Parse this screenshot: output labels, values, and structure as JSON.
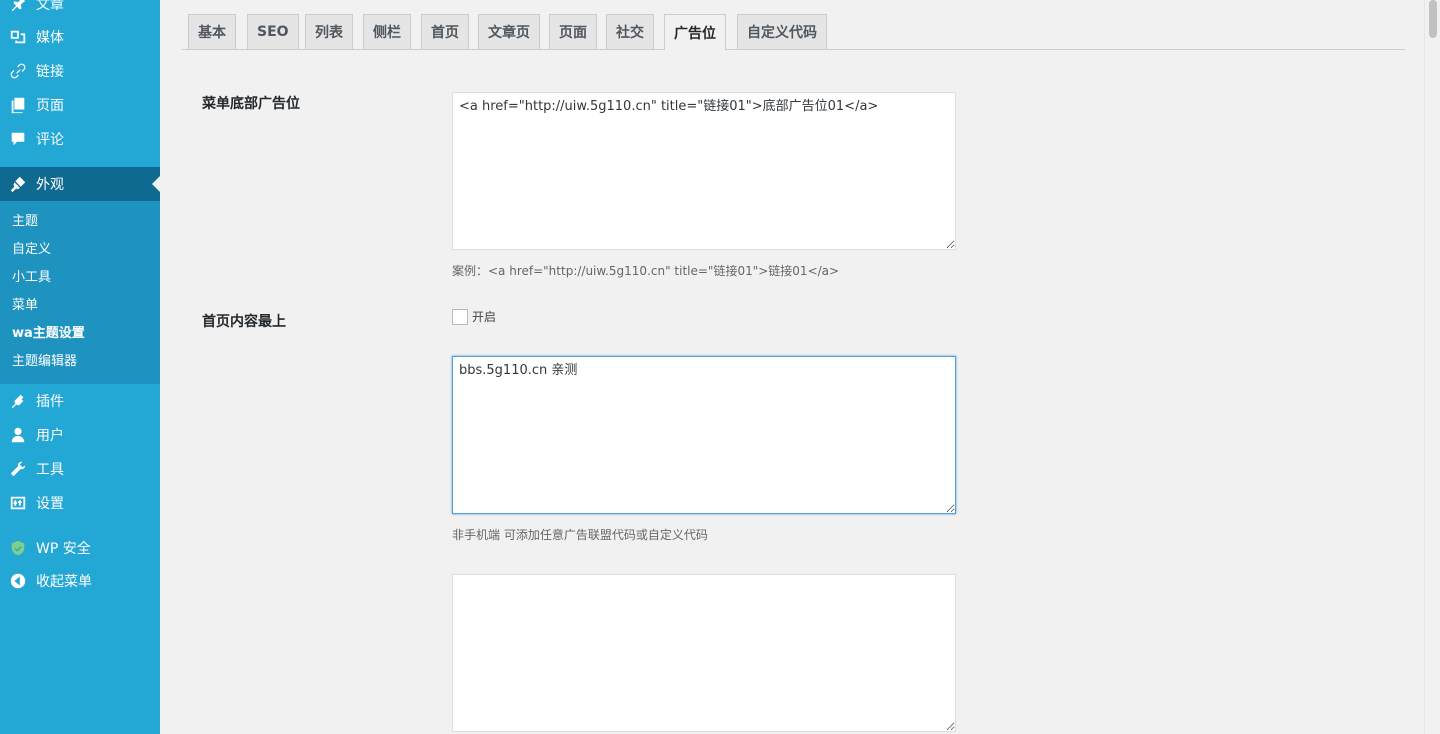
{
  "sidebar": {
    "items": [
      {
        "label": "文章",
        "icon": "pin-icon"
      },
      {
        "label": "媒体",
        "icon": "media-icon"
      },
      {
        "label": "链接",
        "icon": "link-icon"
      },
      {
        "label": "页面",
        "icon": "page-icon"
      },
      {
        "label": "评论",
        "icon": "comment-icon"
      },
      {
        "label": "外观",
        "icon": "brush-icon",
        "current": true
      },
      {
        "label": "插件",
        "icon": "plugin-icon"
      },
      {
        "label": "用户",
        "icon": "user-icon"
      },
      {
        "label": "工具",
        "icon": "wrench-icon"
      },
      {
        "label": "设置",
        "icon": "settings-icon"
      },
      {
        "label": "WP 安全",
        "icon": "shield-icon"
      },
      {
        "label": "收起菜单",
        "icon": "collapse-icon"
      }
    ],
    "submenu": [
      {
        "label": "主题"
      },
      {
        "label": "自定义"
      },
      {
        "label": "小工具"
      },
      {
        "label": "菜单"
      },
      {
        "label": "wa主题设置",
        "current": true
      },
      {
        "label": "主题编辑器"
      }
    ]
  },
  "tabs": [
    "基本",
    "SEO",
    "列表",
    "侧栏",
    "首页",
    "文章页",
    "页面",
    "社交",
    "广告位",
    "自定义代码"
  ],
  "active_tab": "广告位",
  "fields": {
    "menu_bottom_ad": {
      "label": "菜单底部广告位",
      "value": "<a href=\"http://uiw.5g110.cn\" title=\"链接01\">底部广告位01</a>",
      "hint": "案例：<a href=\"http://uiw.5g110.cn\" title=\"链接01\">链接01</a>"
    },
    "home_top": {
      "label": "首页内容最上",
      "checkbox_label": "开启",
      "checked": false,
      "value": "bbs.5g110.cn 亲测",
      "hint": "非手机端 可添加任意广告联盟代码或自定义代码",
      "value2": ""
    }
  },
  "colors": {
    "sidebar_bg": "#23a7d4",
    "sidebar_current": "#0e6a90",
    "submenu_bg": "#1e93c0",
    "focus_border": "#5b9dd9"
  }
}
